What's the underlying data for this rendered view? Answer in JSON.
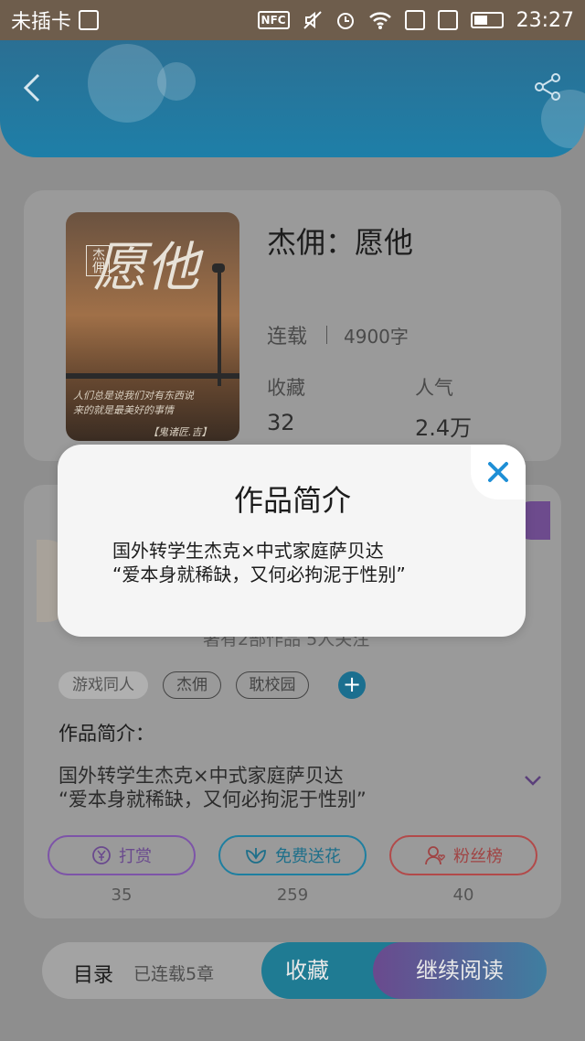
{
  "status_bar": {
    "carrier": "未插卡",
    "time": "23:27",
    "nfc": "NFC",
    "icons": [
      "sim-icon",
      "nfc-icon",
      "mute-icon",
      "alarm-icon",
      "wifi-icon",
      "sim-status-icon",
      "data-icon",
      "battery-icon"
    ]
  },
  "header": {
    "back_icon": "chevron-left-icon",
    "share_icon": "share-icon"
  },
  "book": {
    "title": "杰佣：愿他",
    "status": "连载",
    "word_count": "4900字",
    "favorites_label": "收藏",
    "favorites_value": "32",
    "popularity_label": "人气",
    "popularity_value": "2.4万",
    "cover": {
      "title_text": "愿他",
      "tag_text": "杰佣",
      "line1": "人们总是说我们对有东西说",
      "line2": "来的就是最美好的事情",
      "signature": "【鬼诸匠.吉】"
    }
  },
  "author": {
    "subtitle": "著有2部作品 5人关注"
  },
  "tags": [
    "游戏同人",
    "杰佣",
    "耽校园"
  ],
  "intro": {
    "heading": "作品简介：",
    "line1": "国外转学生杰克×中式家庭萨贝达",
    "line2": "“爱本身就稀缺，又何必拘泥于性别”"
  },
  "actions": [
    {
      "label": "打赏",
      "count": "35",
      "icon": "yuan-coin-icon",
      "color": "#7d54a8"
    },
    {
      "label": "免费送花",
      "count": "259",
      "icon": "flower-icon",
      "color": "#1e7fa0"
    },
    {
      "label": "粉丝榜",
      "count": "40",
      "icon": "fan-ranking-icon",
      "color": "#b24a4a"
    }
  ],
  "bottom_bar": {
    "toc_label": "目录",
    "toc_sub": "已连载5章",
    "favorite_button": "收藏",
    "read_button": "继续阅读"
  },
  "modal": {
    "title": "作品简介",
    "line1": "国外转学生杰克×中式家庭萨贝达",
    "line2": "“爱本身就稀缺，又何必拘泥于性别”",
    "close_icon": "close-icon",
    "close_color": "#1e8fd6"
  }
}
